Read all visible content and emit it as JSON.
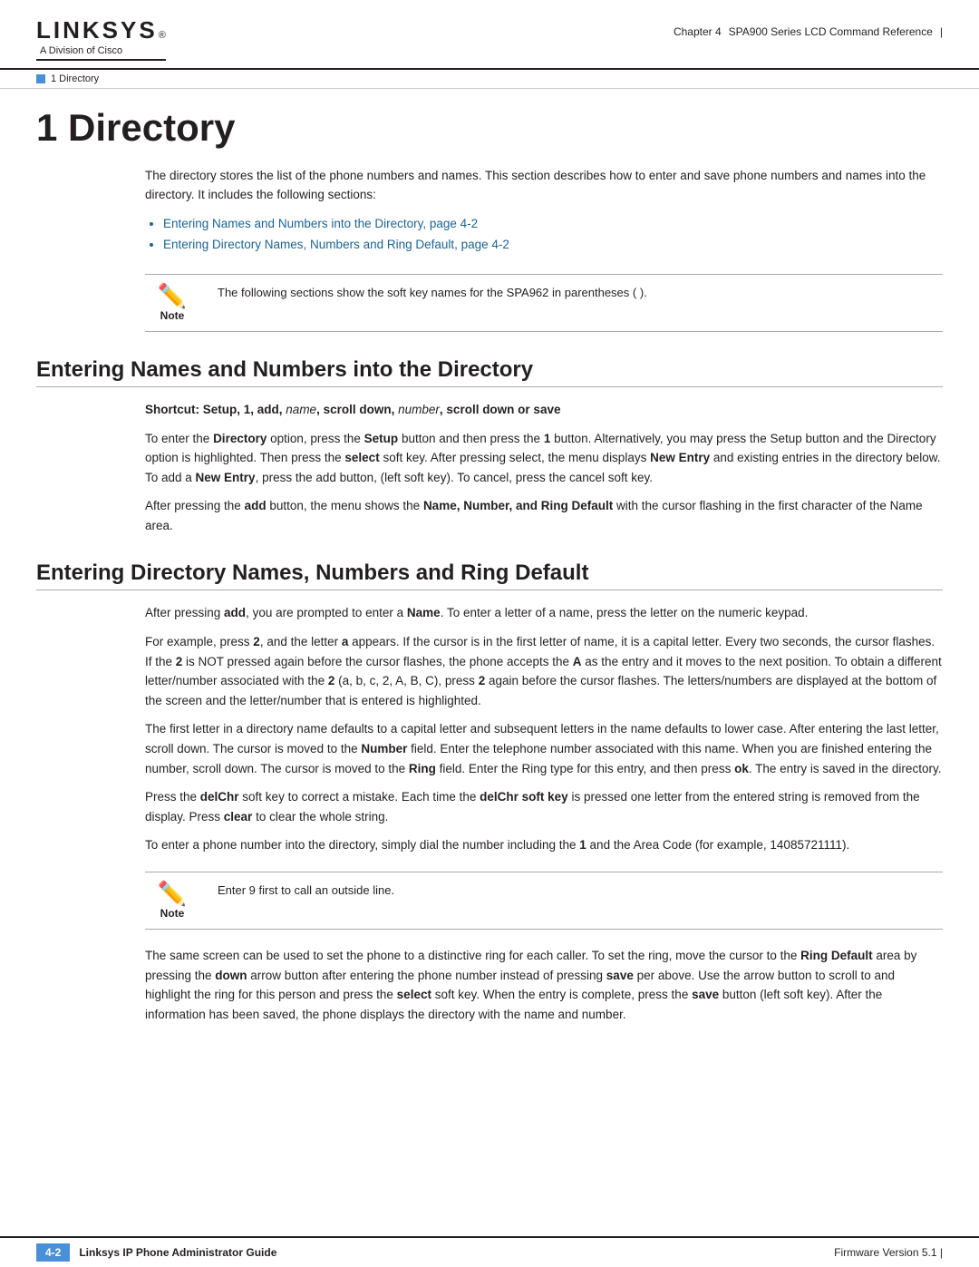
{
  "header": {
    "logo_name": "LINKSYS",
    "logo_reg": "®",
    "logo_division": "A Division of Cisco",
    "chapter_label": "Chapter 4",
    "chapter_title_short": "SPA900 Series LCD Command Reference"
  },
  "breadcrumb": {
    "text": "1 Directory"
  },
  "page_title": "1 Directory",
  "intro": {
    "paragraph": "The directory stores the list of the phone numbers and names. This section describes how to enter and save phone numbers and names into the directory. It includes the following sections:",
    "links": [
      "Entering Names and Numbers into the Directory, page 4-2",
      "Entering Directory Names, Numbers and Ring Default, page 4-2"
    ]
  },
  "note1": {
    "label": "Note",
    "text": "The following sections show the soft key names for the SPA962 in parentheses ( )."
  },
  "section1": {
    "heading": "Entering Names and Numbers into the Directory",
    "shortcut": "Shortcut: Setup, 1, add, name, scroll down, number, scroll down or save",
    "paragraphs": [
      "To enter the Directory option, press the Setup button and then press the 1 button. Alternatively, you may press the Setup button and the Directory option is highlighted. Then press the select soft key. After pressing select, the menu displays New Entry and existing entries in the directory below. To add a New Entry, press the add button, (left soft key). To cancel, press the cancel soft key.",
      "After pressing the add button, the menu shows the Name, Number, and Ring Default with the cursor flashing in the first character of the Name area."
    ]
  },
  "section2": {
    "heading": "Entering Directory Names, Numbers and Ring Default",
    "paragraphs": [
      "After pressing add, you are prompted to enter a Name. To enter a letter of a name, press the letter on the numeric keypad.",
      "For example, press 2, and the letter a appears. If the cursor is in the first letter of name, it is a capital letter. Every two seconds, the cursor flashes. If the 2 is NOT pressed again before the cursor flashes, the phone accepts the A as the entry and it moves to the next position. To obtain a different letter/number associated with the 2 (a, b, c, 2, A, B, C), press 2 again before the cursor flashes. The letters/numbers are displayed at the bottom of the screen and the letter/number that is entered is highlighted.",
      "The first letter in a directory name defaults to a capital letter and subsequent letters in the name defaults to lower case. After entering the last letter, scroll down. The cursor is moved to the Number field. Enter the telephone number associated with this name. When you are finished entering the number, scroll down. The cursor is moved to the Ring field. Enter the Ring type for this entry, and then press ok. The entry is saved in the directory.",
      "Press the delChr soft key to correct a mistake. Each time the delChr soft key is pressed one letter from the entered string is removed from the display. Press clear to clear the whole string.",
      "To enter a phone number into the directory, simply dial the number including the 1 and the Area Code (for example, 14085721111)."
    ]
  },
  "note2": {
    "label": "Note",
    "text": "Enter 9 first to call an outside line."
  },
  "section2_continued": {
    "paragraphs": [
      "The same screen can be used to set the phone to a distinctive ring for each caller. To set the ring, move the cursor to the Ring Default area by pressing the down arrow button after entering the phone number instead of pressing save per above. Use the arrow button to scroll to and highlight the ring for this person and press the select soft key. When the entry is complete, press the save button (left soft key). After the information has been saved, the phone displays the directory with the name and number."
    ]
  },
  "footer": {
    "page_number": "4-2",
    "guide_title": "Linksys IP Phone Administrator Guide",
    "firmware_label": "Firmware Version 5.1"
  }
}
